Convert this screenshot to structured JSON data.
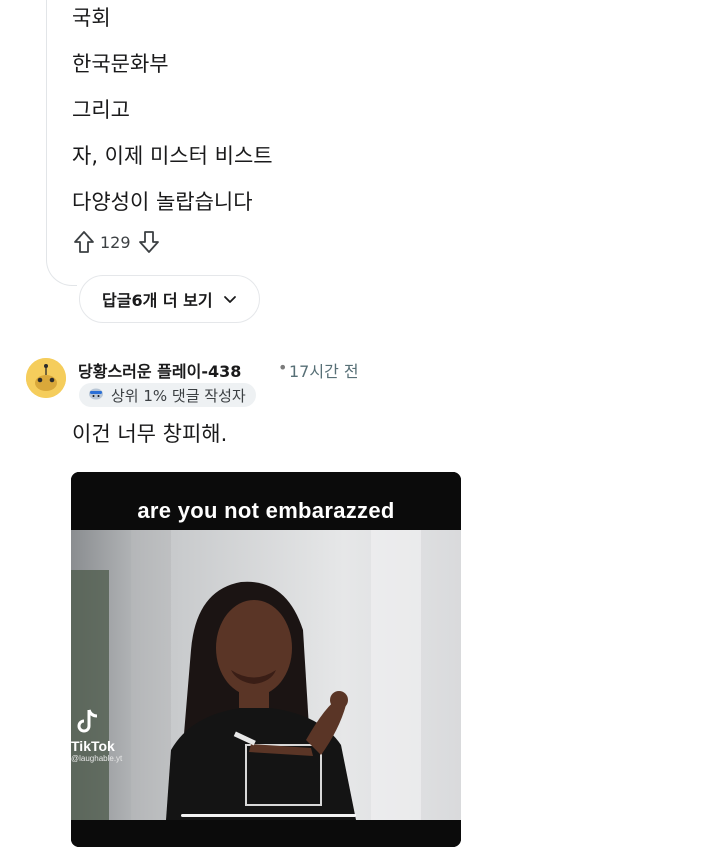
{
  "parent_comment": {
    "lines": [
      "국회",
      "한국문화부",
      "그리고",
      "자, 이제 미스터 비스트",
      "다양성이 놀랍습니다"
    ],
    "score": "129",
    "more_replies_label": "답글6개 더 보기"
  },
  "comment": {
    "username": "당황스러운 플레이-438",
    "separator": "•",
    "time_ago": "17시간 전",
    "badge_icon": "top-commenter-icon",
    "badge_label": "상위 1% 댓글 작성자",
    "body": "이건 너무 창피해.",
    "avatar_color": "#f5cd5c",
    "video": {
      "caption": "are you not embarazzed",
      "watermark": "TikTok",
      "watermark_handle": "@laughable.yt",
      "progress": 0.0
    }
  },
  "colors": {
    "text": "#1a1a1b",
    "muted": "#576f76",
    "thread_line": "#e2e5e8",
    "badge_bg": "#eef1f3"
  }
}
